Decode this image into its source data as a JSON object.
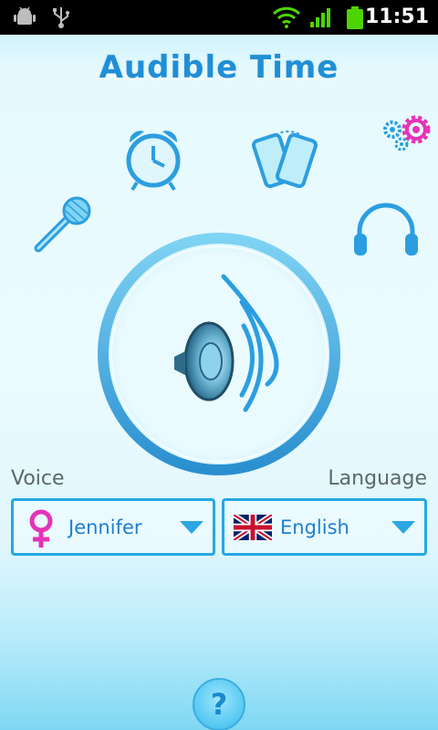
{
  "status_bar": {
    "time": "11:51"
  },
  "app": {
    "title": "Audible Time"
  },
  "settings": {
    "voice_label": "Voice",
    "voice_value": "Jennifer",
    "language_label": "Language",
    "language_value": "English"
  },
  "help": {
    "symbol": "?"
  },
  "colors": {
    "accent": "#24a8e3",
    "title": "#1f8fd6",
    "female": "#e633b8"
  }
}
